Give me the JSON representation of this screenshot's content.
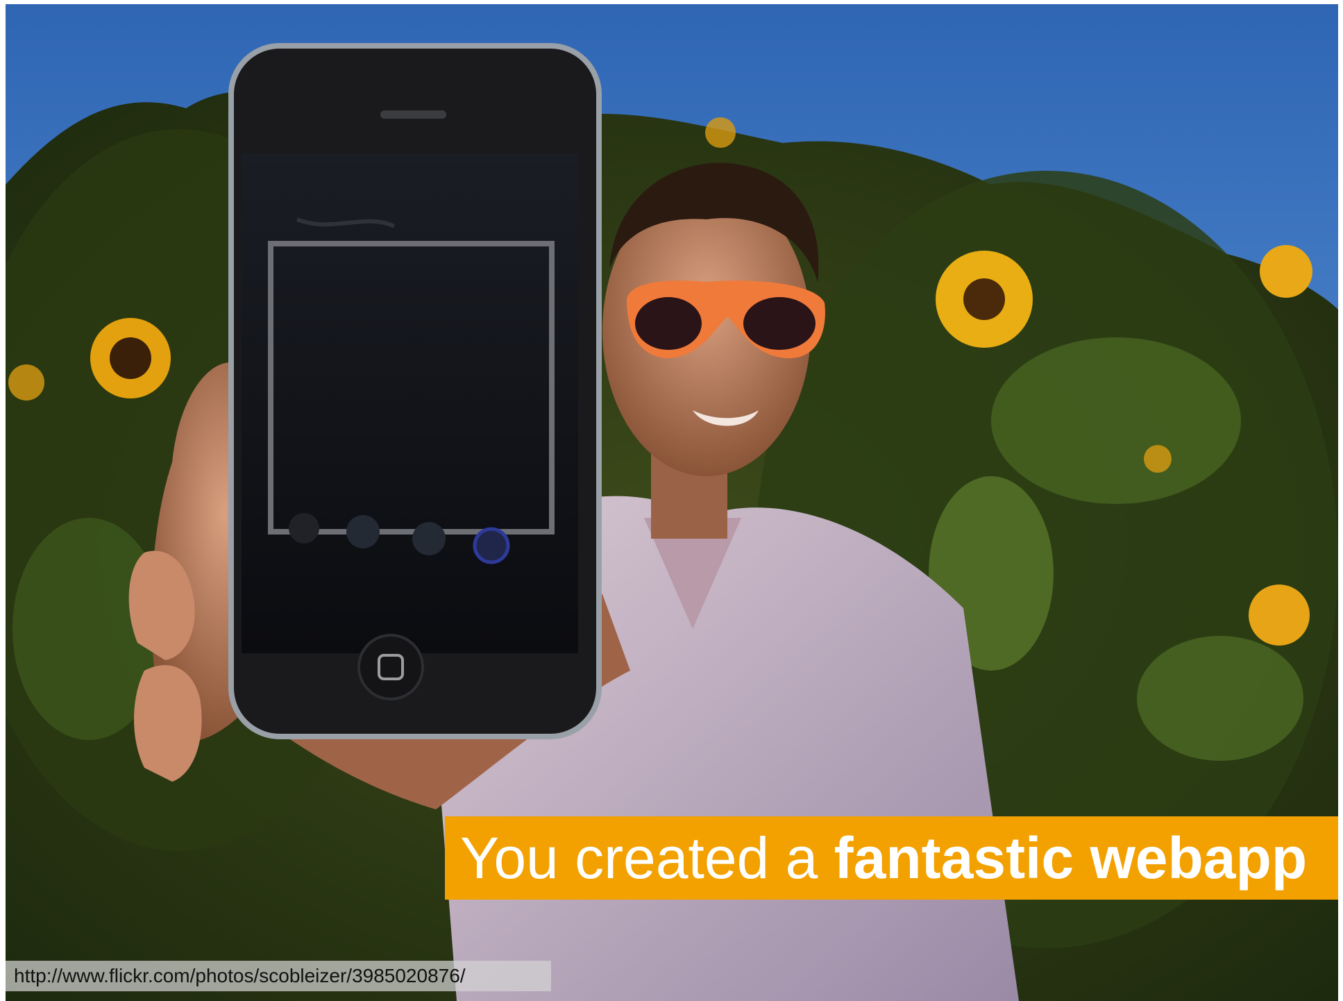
{
  "slide": {
    "caption": {
      "lead": "You created a ",
      "emphasis": "fantastic webapp"
    },
    "credit_url": "http://www.flickr.com/photos/scobleizer/3985020876/"
  },
  "colors": {
    "caption_bg": "#f2a100",
    "sky": "#3f78c2"
  }
}
